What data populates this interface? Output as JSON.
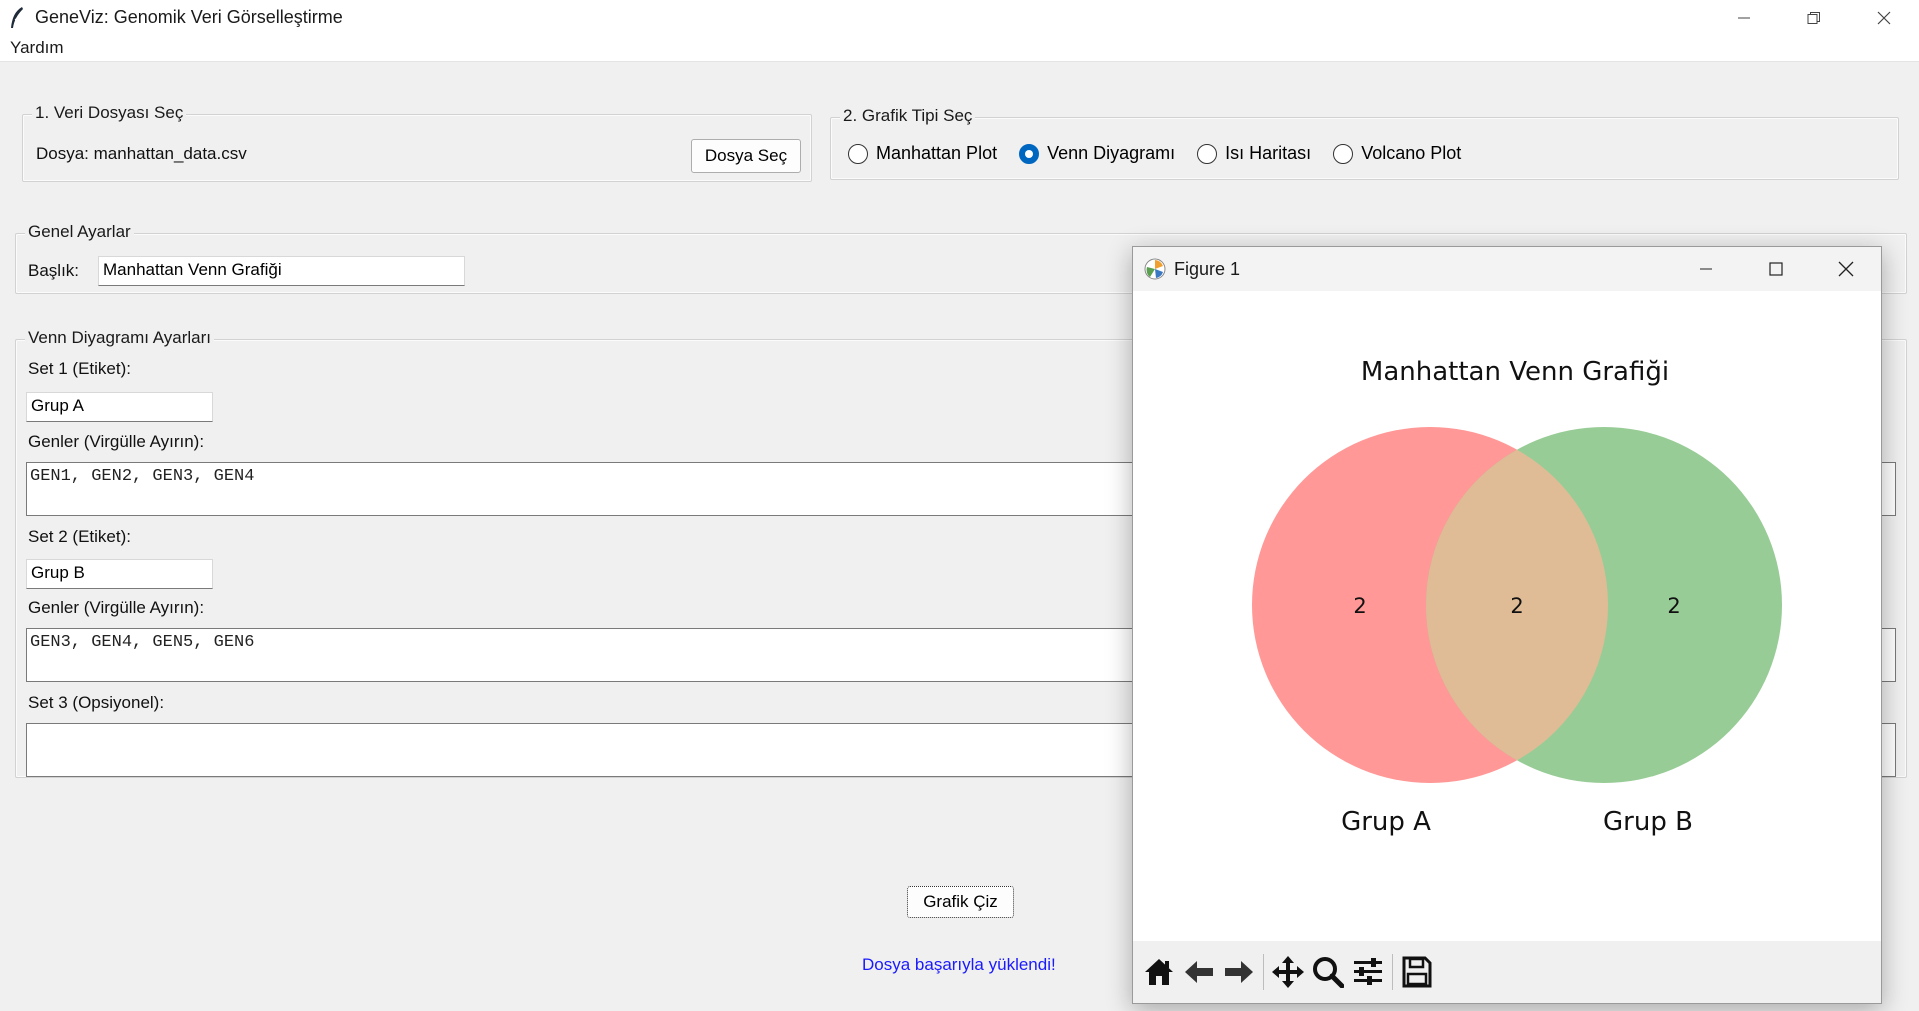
{
  "window": {
    "title": "GeneViz: Genomik Veri Görselleştirme",
    "menu": [
      "Yardım"
    ]
  },
  "data_file": {
    "legend": "1. Veri Dosyası Seç",
    "file_label": "Dosya: manhattan_data.csv",
    "button": "Dosya Seç"
  },
  "chart_type": {
    "legend": "2. Grafik Tipi Seç",
    "options": [
      "Manhattan Plot",
      "Venn Diyagramı",
      "Isı Haritası",
      "Volcano Plot"
    ],
    "selected": "Venn Diyagramı"
  },
  "general": {
    "legend": "Genel Ayarlar",
    "title_label": "Başlık:",
    "title_value": "Manhattan Venn Grafiği"
  },
  "venn_settings": {
    "legend": "Venn Diyagramı Ayarları",
    "set1_label": "Set 1 (Etiket):",
    "set1_value": "Grup A",
    "genes1_label": "Genler (Virgülle Ayırın):",
    "genes1_value": "GEN1, GEN2, GEN3, GEN4",
    "set2_label": "Set 2 (Etiket):",
    "set2_value": "Grup B",
    "genes2_label": "Genler (Virgülle Ayırın):",
    "genes2_value": "GEN3, GEN4, GEN5, GEN6",
    "set3_label": "Set 3 (Opsiyonel):",
    "set3_value": ""
  },
  "draw_button": "Grafik Çiz",
  "status": "Dosya başarıyla yüklendi!",
  "colors": {
    "status_text": "#1a1aff",
    "radio_selected": "#0067c0",
    "set_a": "#ff9896",
    "set_b": "#98cc96",
    "overlap": "#dfbc96"
  },
  "figure": {
    "window_title": "Figure 1",
    "toolbar_icons": [
      "home-icon",
      "back-arrow-icon",
      "forward-arrow-icon",
      "pan-icon",
      "zoom-icon",
      "configure-subplots-icon",
      "save-icon"
    ]
  },
  "chart_data": {
    "type": "venn",
    "title": "Manhattan Venn Grafiği",
    "sets": [
      {
        "name": "Grup A",
        "only": 2
      },
      {
        "name": "Grup B",
        "only": 2
      }
    ],
    "regions": [
      {
        "label": "Grup A only",
        "value": 2
      },
      {
        "label": "Grup A ∩ Grup B",
        "value": 2
      },
      {
        "label": "Grup B only",
        "value": 2
      }
    ]
  }
}
